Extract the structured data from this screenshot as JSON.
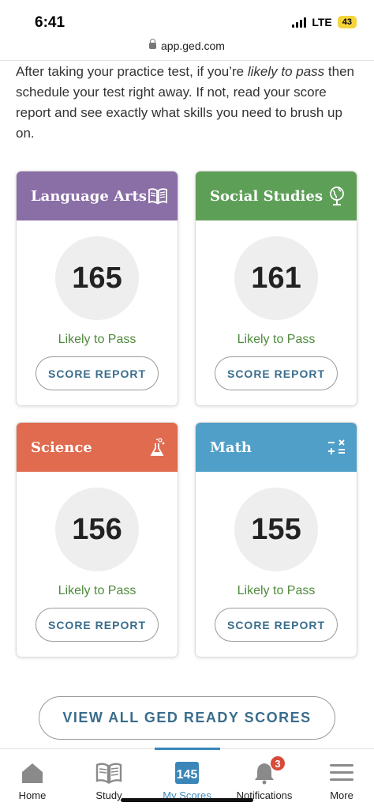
{
  "status_bar": {
    "time": "6:41",
    "network": "LTE",
    "battery": "43"
  },
  "browser": {
    "url": "app.ged.com"
  },
  "intro": {
    "before": "After taking your practice test, if you’re ",
    "emphasis": "likely to pass",
    "after": " then schedule your test right away. If not, read your score report and see exactly what skills you need to brush up on."
  },
  "cards": [
    {
      "subject": "Language Arts",
      "score": "165",
      "status": "Likely to Pass",
      "button": "SCORE REPORT",
      "color": "#8a6ea6",
      "icon": "book-icon"
    },
    {
      "subject": "Social Studies",
      "score": "161",
      "status": "Likely to Pass",
      "button": "SCORE REPORT",
      "color": "#5e9f58",
      "icon": "globe-icon"
    },
    {
      "subject": "Science",
      "score": "156",
      "status": "Likely to Pass",
      "button": "SCORE REPORT",
      "color": "#e06b4f",
      "icon": "flask-icon"
    },
    {
      "subject": "Math",
      "score": "155",
      "status": "Likely to Pass",
      "button": "SCORE REPORT",
      "color": "#4f9fc8",
      "icon": "math-operators-icon"
    }
  ],
  "view_all": "VIEW ALL GED READY SCORES",
  "nav": {
    "items": [
      {
        "label": "Home",
        "icon": "home-icon"
      },
      {
        "label": "Study",
        "icon": "book-icon"
      },
      {
        "label": "My Scores",
        "icon": "scores-icon",
        "active": true
      },
      {
        "label": "Notifications",
        "icon": "bell-icon",
        "badge": "3"
      },
      {
        "label": "More",
        "icon": "hamburger-icon"
      }
    ]
  },
  "colors": {
    "accent": "#3a86b8",
    "pass_text": "#4f8a3c",
    "button_text": "#3a6d8c"
  }
}
